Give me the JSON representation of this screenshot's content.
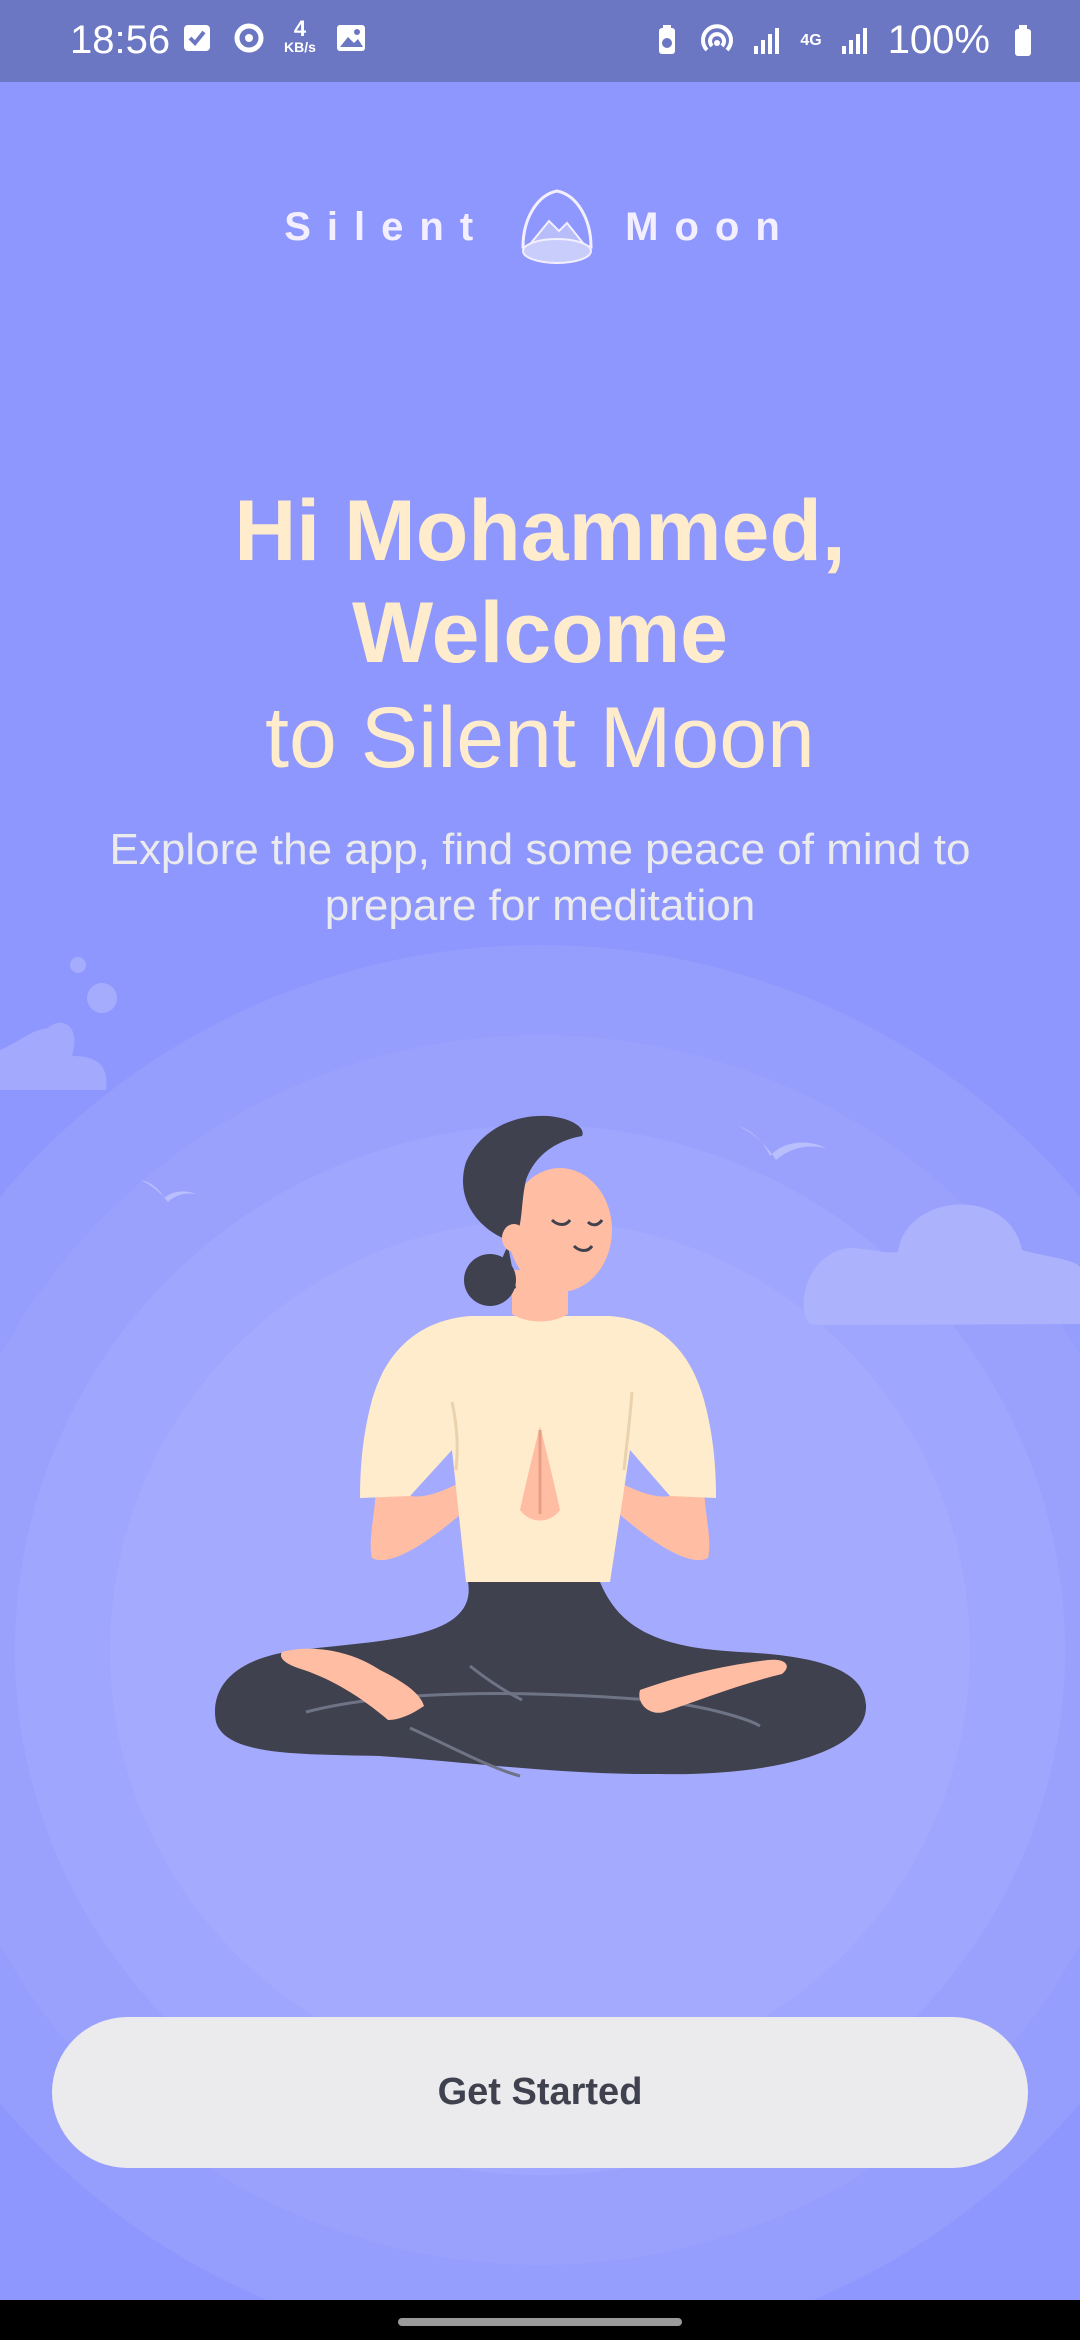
{
  "status_bar": {
    "time": "18:56",
    "net_speed_value": "4",
    "net_speed_unit": "KB/s",
    "network_type": "4G",
    "battery": "100%",
    "icons": [
      "checkbox-icon",
      "sync-icon",
      "image-icon",
      "battery-saver-icon",
      "hotspot-icon",
      "signal-icon",
      "signal-icon",
      "battery-icon"
    ]
  },
  "logo": {
    "left_word": "Silent",
    "right_word": "Moon",
    "icon": "moon-mountain-icon"
  },
  "welcome": {
    "line1": "Hi Mohammed,",
    "line2": "Welcome",
    "line3": "to Silent Moon"
  },
  "subtitle": "Explore the app, find some peace of mind to prepare for meditation",
  "illustration": "meditating-woman-illustration",
  "cta": {
    "label": "Get Started"
  },
  "colors": {
    "background": "#8E97FD",
    "status_bar": "#6C77C4",
    "headline": "#FFECCC",
    "button_bg": "#EBEAEC",
    "button_text": "#3F414E"
  }
}
